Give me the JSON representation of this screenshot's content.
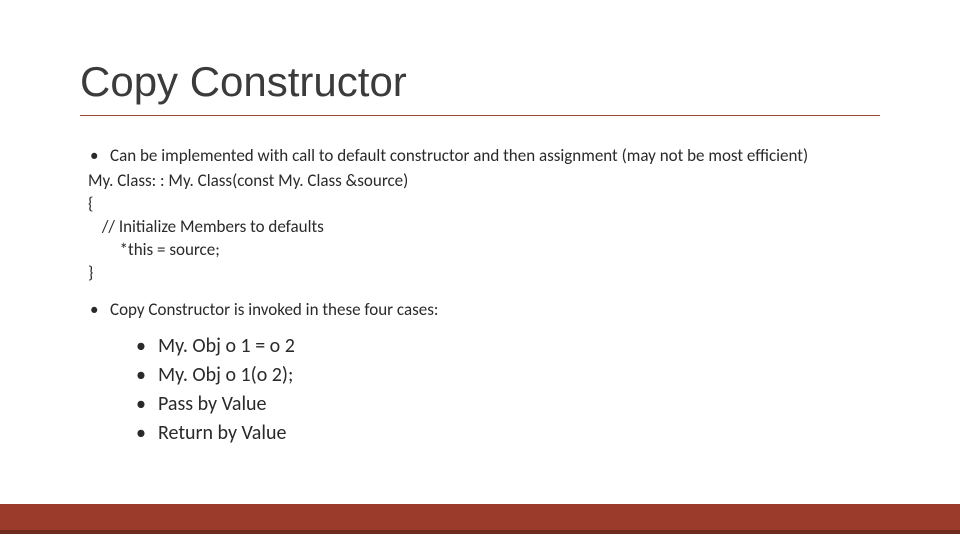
{
  "title": "Copy Constructor",
  "bullet1": "Can be implemented with call to default constructor and then assignment (may not be most efficient)",
  "code": {
    "l1": "My. Class: : My. Class(const My. Class &source)",
    "l2": "{",
    "l3": " // Initialize Members to defaults",
    "l4": "   *this = source;",
    "l5": "}"
  },
  "bullet2": "Copy Constructor is invoked in these four cases:",
  "sub": [
    "My. Obj o 1 = o 2",
    "My. Obj o 1(o 2);",
    "Pass by Value",
    "Return by Value"
  ]
}
